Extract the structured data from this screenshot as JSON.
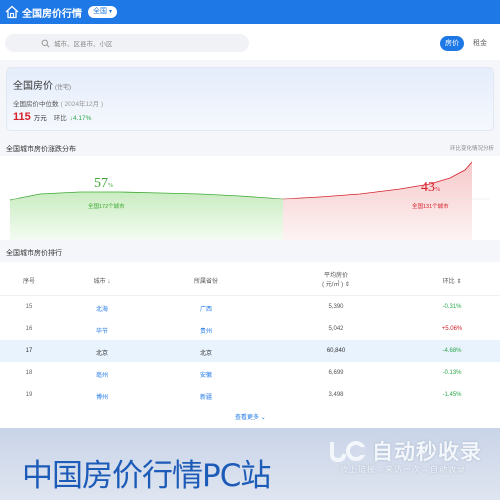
{
  "header": {
    "brand": "全国房价行情",
    "city_selector": "全国",
    "logo_icon": "house-icon"
  },
  "search": {
    "placeholder": "城市、区县市、小区",
    "icon": "search-icon"
  },
  "tabs": {
    "price": "房价",
    "rent": "租金"
  },
  "summary": {
    "title": "全国房价",
    "title_sub": "(住宅)",
    "label": "全国房价中位数",
    "date": "( 2024年12月 )",
    "value": "115",
    "unit": "万元",
    "yoy_label": "环比",
    "yoy_value": "↓4.17%"
  },
  "distribution": {
    "title": "全国城市房价涨跌分布",
    "link": "环比变化情况分析",
    "down_pct": "57",
    "down_caption": "全国172个城市",
    "up_pct": "43",
    "up_caption": "全国131个城市",
    "percent_sign": "%",
    "colors": {
      "down": "#3fa835",
      "up": "#d6202a"
    }
  },
  "chart_data": {
    "type": "area",
    "title": "全国城市房价涨跌分布",
    "series": [
      {
        "name": "全国172个城市",
        "share_pct": 57,
        "direction": "down"
      },
      {
        "name": "全国131个城市",
        "share_pct": 43,
        "direction": "up"
      }
    ]
  },
  "ranking": {
    "title": "全国城市房价排行",
    "columns": [
      "序号",
      "城市",
      "所属省份",
      "平均房价",
      "( 元/㎡ )",
      "环比"
    ],
    "rows": [
      {
        "idx": "15",
        "city": "北海",
        "province": "广西",
        "price": "5,390",
        "change": "-0.31%",
        "dir": "down"
      },
      {
        "idx": "16",
        "city": "毕节",
        "province": "贵州",
        "price": "5,042",
        "change": "+5.06%",
        "dir": "up"
      },
      {
        "idx": "17",
        "city": "北京",
        "province": "北京",
        "price": "60,840",
        "change": "-4.68%",
        "dir": "down"
      },
      {
        "idx": "18",
        "city": "亳州",
        "province": "安徽",
        "price": "6,699",
        "change": "-0.13%",
        "dir": "down"
      },
      {
        "idx": "19",
        "city": "博州",
        "province": "新疆",
        "price": "3,498",
        "change": "-1.45%",
        "dir": "down"
      }
    ],
    "more": "查看更多 ⌄"
  },
  "banner": {
    "title": "中国房价行情PC站",
    "watermark": "自动秒收录",
    "watermark_sub": "收上链接→来访一次→自动收录"
  }
}
